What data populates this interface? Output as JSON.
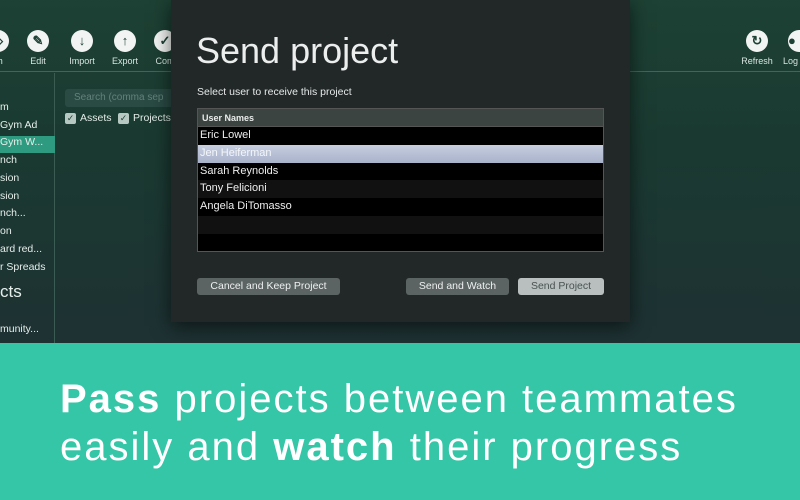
{
  "toolbar": {
    "items": [
      {
        "label": "ch",
        "icon": "search-icon"
      },
      {
        "label": "Edit",
        "icon": "edit-icon"
      },
      {
        "label": "Import",
        "icon": "import-icon"
      },
      {
        "label": "Export",
        "icon": "export-icon"
      },
      {
        "label": "Com",
        "icon": "checkmark-icon"
      },
      {
        "label": "Refresh",
        "icon": "refresh-icon"
      },
      {
        "label": "Log",
        "icon": "user-icon"
      }
    ]
  },
  "sidebar": {
    "items": [
      "m",
      "Gym Ad",
      "Gym W...",
      "nch",
      "sion",
      "sion",
      "nch...",
      "on",
      "ard red...",
      "r Spreads"
    ],
    "section": "cts",
    "footer_item": "munity..."
  },
  "search": {
    "placeholder": "Search (comma sep"
  },
  "filters": {
    "assets": "Assets",
    "projects": "Projects"
  },
  "dialog": {
    "title": "Send project",
    "label": "Select user to receive this project",
    "column": "User Names",
    "users": [
      "Eric Lowel",
      "Jen Heiferman",
      "Sarah Reynolds",
      "Tony Felicioni",
      "Angela DiTomasso"
    ],
    "selected_user": "Jen Heiferman",
    "cancel": "Cancel and Keep Project",
    "watch": "Send and Watch",
    "send": "Send Project"
  },
  "banner": {
    "line1_bold": "Pass",
    "line1_rest": " projects between teammates",
    "line2_a": "easily and ",
    "line2_bold": "watch",
    "line2_b": " their progress"
  },
  "colors": {
    "accent": "#34c6a7",
    "selection": "#2e9b80"
  }
}
